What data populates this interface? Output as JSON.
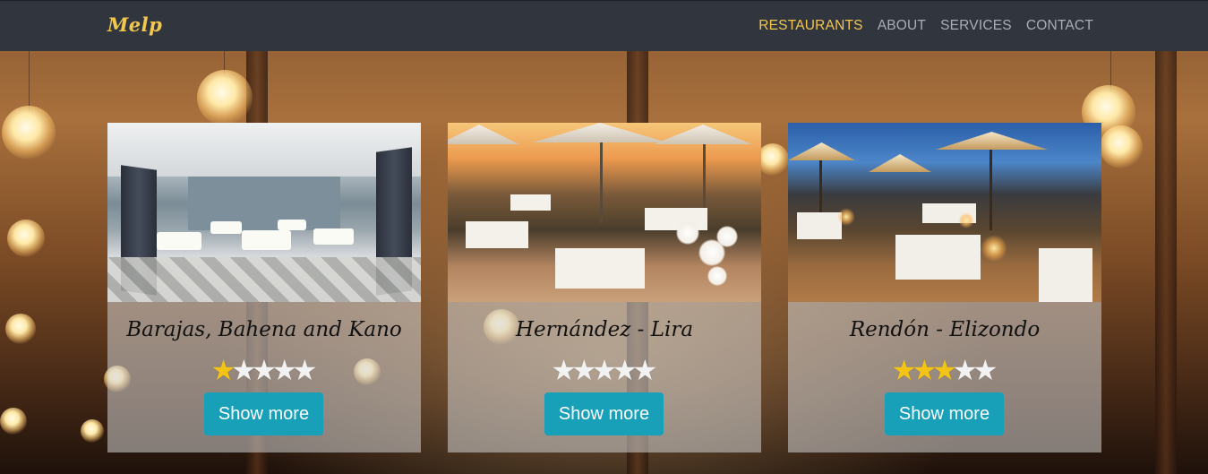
{
  "brand": "Melp",
  "nav": {
    "items": [
      {
        "label": "RESTAURANTS",
        "active": true
      },
      {
        "label": "ABOUT",
        "active": false
      },
      {
        "label": "SERVICES",
        "active": false
      },
      {
        "label": "CONTACT",
        "active": false
      }
    ]
  },
  "colors": {
    "navbar_bg": "#31353d",
    "accent": "#f3c74f",
    "button": "#18a0b8",
    "star_on": "#f3c415",
    "star_off": "#f2f2f2"
  },
  "restaurants": [
    {
      "name": "Barajas, Bahena and Kano",
      "rating": 1,
      "max_rating": 5,
      "button_label": "Show more",
      "image_icon": "banquet-hall-photo"
    },
    {
      "name": "Hernández - Lira",
      "rating": 0,
      "max_rating": 5,
      "button_label": "Show more",
      "image_icon": "sunset-terrace-photo"
    },
    {
      "name": "Rendón - Elizondo",
      "rating": 3,
      "max_rating": 5,
      "button_label": "Show more",
      "image_icon": "dusk-terrace-photo"
    }
  ]
}
